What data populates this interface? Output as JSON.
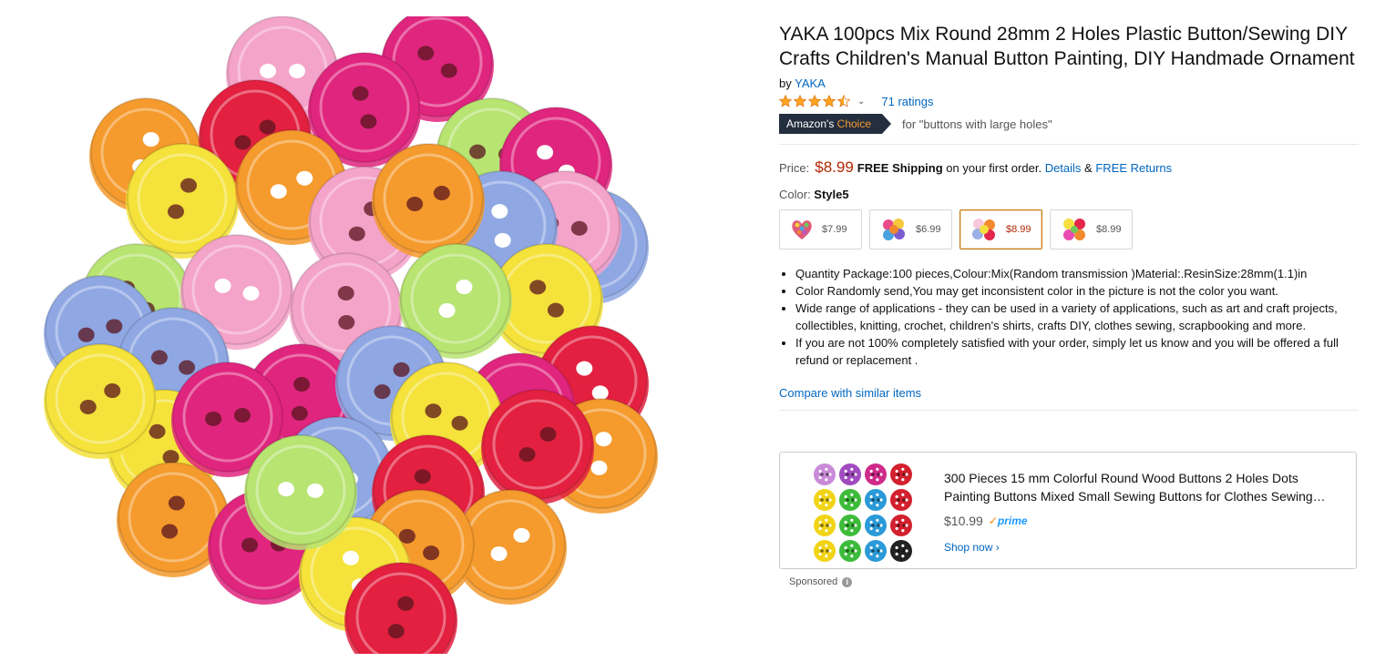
{
  "product": {
    "title": "YAKA 100pcs Mix Round 28mm 2 Holes Plastic Button/Sewing DIY Crafts Children's Manual Button Painting, DIY Handmade Ornament",
    "by_prefix": "by ",
    "brand": "YAKA",
    "rating_stars": 4.5,
    "ratings_text": "71 ratings",
    "badge_main": "Amazon's ",
    "badge_accent": "Choice",
    "choice_for": "for \"buttons with large holes\""
  },
  "price": {
    "label": "Price:",
    "value": "$8.99",
    "shipping_bold": "FREE Shipping",
    "shipping_rest": " on your first order.",
    "details_link": "Details",
    "amp": " & ",
    "returns_link": "FREE Returns"
  },
  "color": {
    "label": "Color: ",
    "selected": "Style5",
    "options": [
      {
        "price": "$7.99"
      },
      {
        "price": "$6.99"
      },
      {
        "price": "$8.99"
      },
      {
        "price": "$8.99"
      }
    ]
  },
  "bullets": [
    "Quantity Package:100 pieces,Colour:Mix(Random transmission )Material:.ResinSize:28mm(1.1)in",
    "Color Randomly send,You may get inconsistent color in the picture is not the color you want.",
    "Wide range of applications - they can be used in a variety of applications, such as art and craft projects, collectibles, knitting, crochet, children's shirts, crafts DIY, clothes sewing, scrapbooking and more.",
    "If you are not 100% completely satisfied with your order, simply let us know and you will be offered a full refund or replacement ."
  ],
  "compare_link": "Compare with similar items",
  "ad": {
    "title": "300 Pieces 15 mm Colorful Round Wood Buttons 2 Holes Dots Painting Buttons Mixed Small Sewing Buttons for Clothes Sewing…",
    "price": "$10.99",
    "prime_check": "✓",
    "prime_text": "prime",
    "shop_link": "Shop now ›"
  },
  "sponsored": {
    "label": "Sponsored",
    "info": "i"
  },
  "colors": {
    "link": "#0066c0",
    "price": "#b12704",
    "badge_bg": "#232f3e",
    "badge_accent": "#f69931",
    "star": "#ffa41c"
  }
}
